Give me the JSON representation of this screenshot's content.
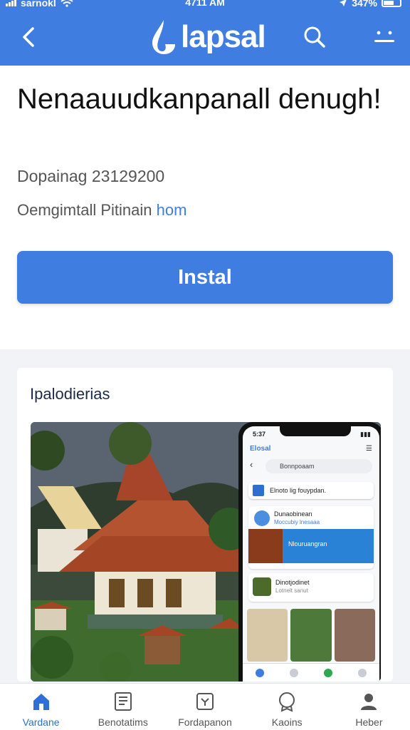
{
  "status_bar": {
    "carrier": "sarnokl",
    "time": "4711 AM",
    "battery": "347%"
  },
  "header": {
    "logo": "lapsal"
  },
  "app": {
    "title": "Nenaauudkanpanall denugh!",
    "updated": "Dopainag 23129200",
    "publisher_prefix": "Oemgimtall Pitinain",
    "publisher_link": "hom",
    "install_label": "Instal"
  },
  "screenshots": {
    "title": "Ipalodierias",
    "phone": {
      "time": "5:37",
      "app_name": "Elosal",
      "search": "Bonnpoaam",
      "banner": "Elnoto lig fouypdan.",
      "post1_title": "Dunaobinean",
      "post1_sub": "Moccubiy lnesaaa",
      "post1_caption": "Nlouruangran",
      "post2_title": "Dinotjodinet",
      "post2_sub": "Lotnelt sanut"
    }
  },
  "bottom_nav": {
    "tabs": [
      {
        "label": "Vardane",
        "icon": "home-icon",
        "active": true
      },
      {
        "label": "Benotatims",
        "icon": "document-icon",
        "active": false
      },
      {
        "label": "Fordapanon",
        "icon": "apps-icon",
        "active": false
      },
      {
        "label": "Kaoins",
        "icon": "badge-icon",
        "active": false
      },
      {
        "label": "Heber",
        "icon": "person-icon",
        "active": false
      }
    ]
  },
  "colors": {
    "primary": "#3f7de0",
    "background": "#f1f3f6"
  }
}
